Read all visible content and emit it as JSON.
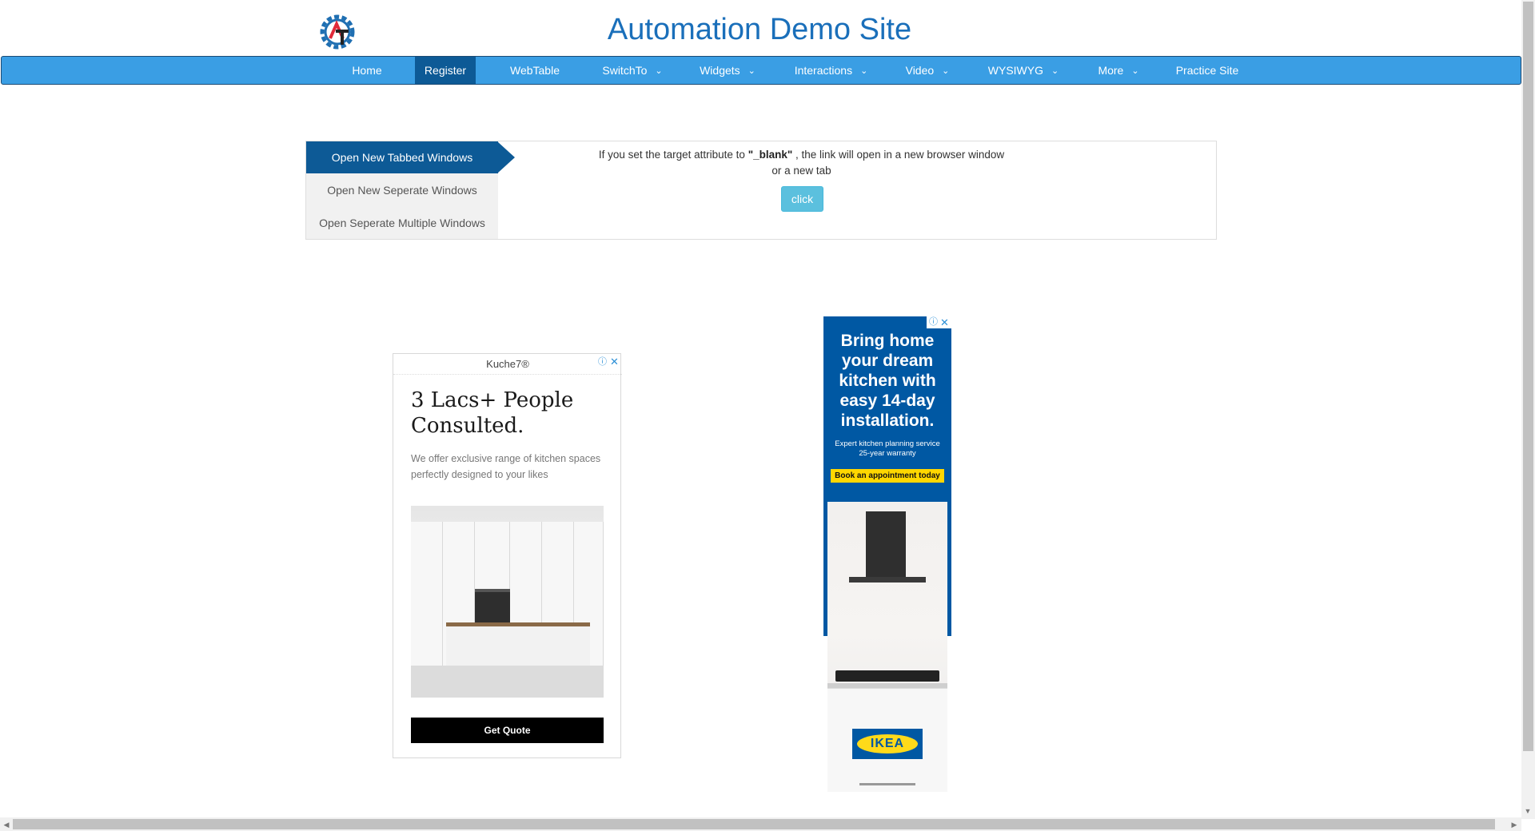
{
  "header": {
    "logo_alt": "AT",
    "title": "Automation Demo Site"
  },
  "nav": {
    "items": [
      {
        "label": "Home",
        "has_dropdown": false
      },
      {
        "label": "Register",
        "has_dropdown": false,
        "active": true
      },
      {
        "label": "WebTable",
        "has_dropdown": false
      },
      {
        "label": "SwitchTo",
        "has_dropdown": true
      },
      {
        "label": "Widgets",
        "has_dropdown": true
      },
      {
        "label": "Interactions",
        "has_dropdown": true
      },
      {
        "label": "Video",
        "has_dropdown": true
      },
      {
        "label": "WYSIWYG",
        "has_dropdown": true
      },
      {
        "label": "More",
        "has_dropdown": true
      },
      {
        "label": "Practice Site",
        "has_dropdown": false
      }
    ],
    "dropdown_icon": "chevron-down-icon"
  },
  "tabs": {
    "items": [
      {
        "label": "Open New Tabbed Windows",
        "active": true
      },
      {
        "label": "Open New Seperate Windows"
      },
      {
        "label": "Open Seperate Multiple Windows"
      }
    ],
    "description_prefix": "If you set the target attribute to ",
    "description_code": "\"_blank\"",
    "description_suffix": " , the link will open in a new browser window",
    "description_line2": "or a new tab",
    "button_label": "click"
  },
  "ad1": {
    "brand": "Kuche7®",
    "headline": "3 Lacs+ People Consulted.",
    "body": "We offer exclusive range of kitchen spaces perfectly designed to your likes",
    "cta": "Get Quote"
  },
  "ad2": {
    "headline": "Bring home your dream kitchen with easy 14-day installation.",
    "subline1": "Expert kitchen planning service",
    "subline2": "25-year warranty",
    "cta": "Book an appointment today",
    "logo_text": "IKEA"
  },
  "colors": {
    "nav_bg": "#3a9ee4",
    "nav_active": "#0d5a96",
    "title": "#1a6fba",
    "button": "#5bc0de",
    "ikea_blue": "#0058a3",
    "ikea_yellow": "#ffda1a"
  }
}
